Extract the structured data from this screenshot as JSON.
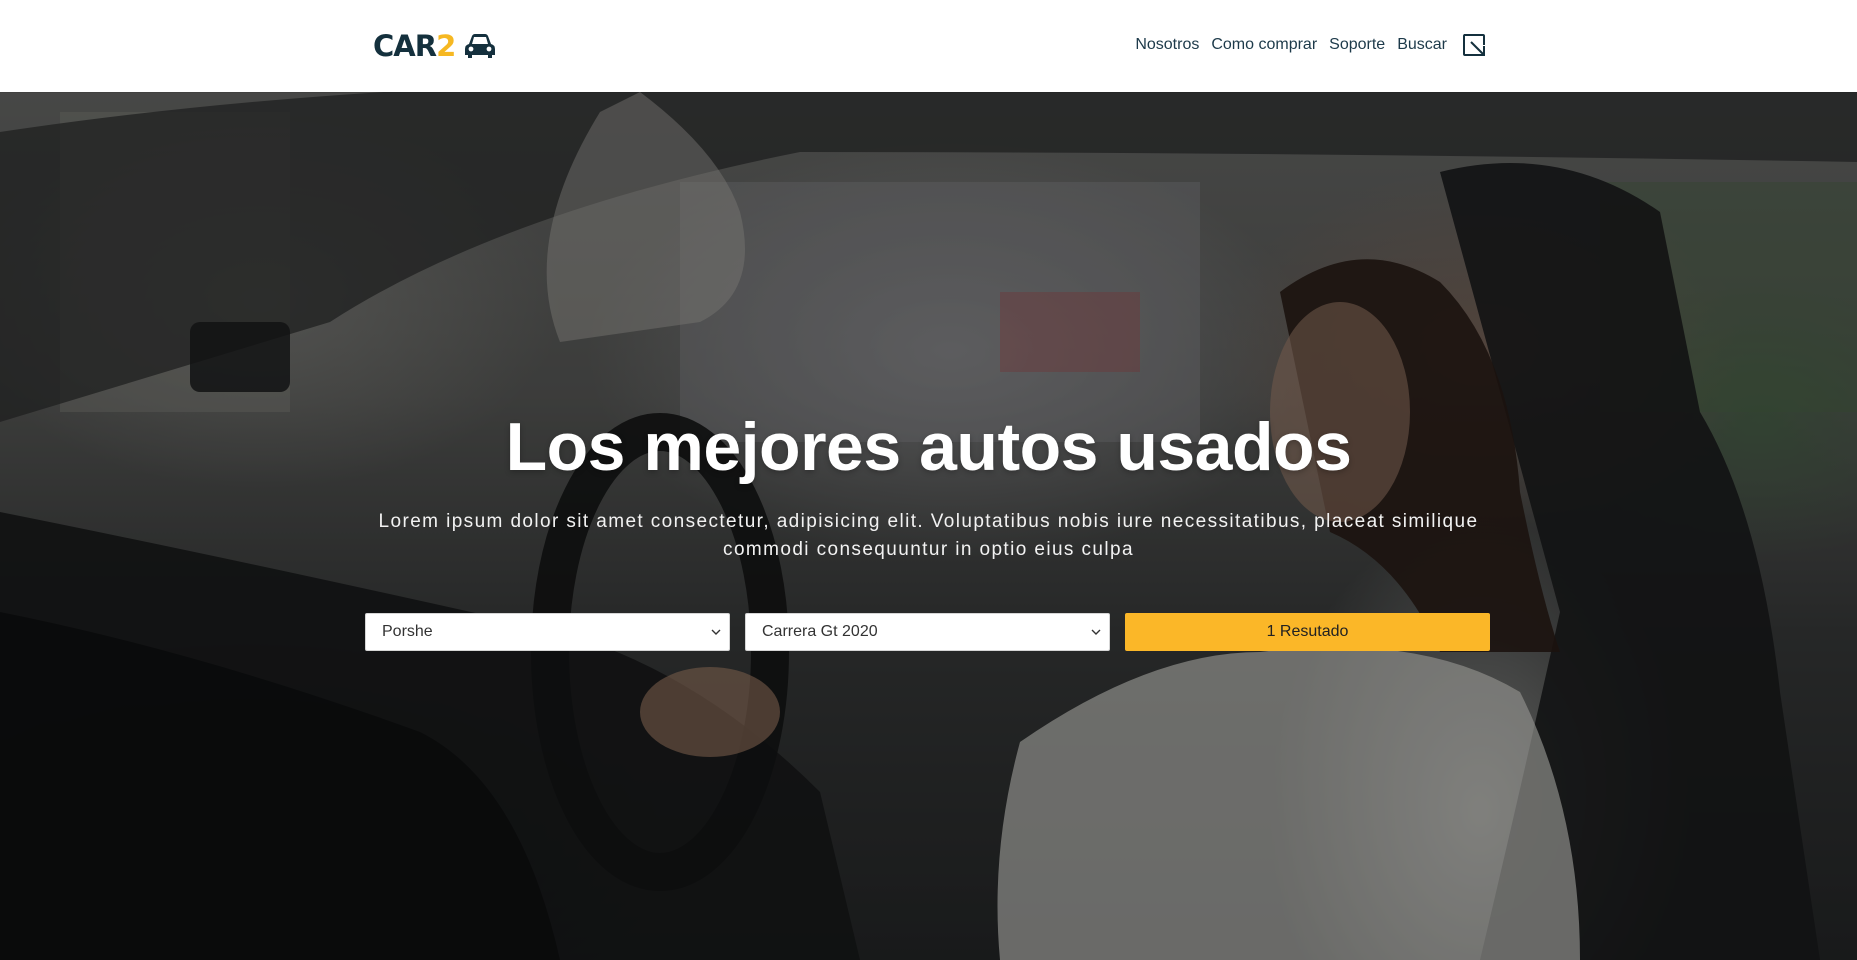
{
  "header": {
    "logo": {
      "text_main": "CAR",
      "text_accent": "2",
      "icon": "car-icon"
    },
    "nav": [
      {
        "label": "Nosotros"
      },
      {
        "label": "Como comprar"
      },
      {
        "label": "Soporte"
      },
      {
        "label": "Buscar"
      }
    ],
    "nav_icon": "arrow-down-right-square-icon"
  },
  "hero": {
    "title": "Los mejores autos usados",
    "subtitle": "Lorem ipsum dolor sit amet consectetur, adipisicing elit. Voluptatibus nobis iure necessitatibus, placeat similique commodi consequuntur in optio eius culpa",
    "search": {
      "brand_select": {
        "value": "Porshe"
      },
      "model_select": {
        "value": "Carrera Gt 2020"
      },
      "result_button": {
        "label": "1 Resutado"
      }
    }
  },
  "colors": {
    "brand_dark": "#14303d",
    "accent": "#fbb728",
    "nav_text": "#1d3a4a"
  }
}
